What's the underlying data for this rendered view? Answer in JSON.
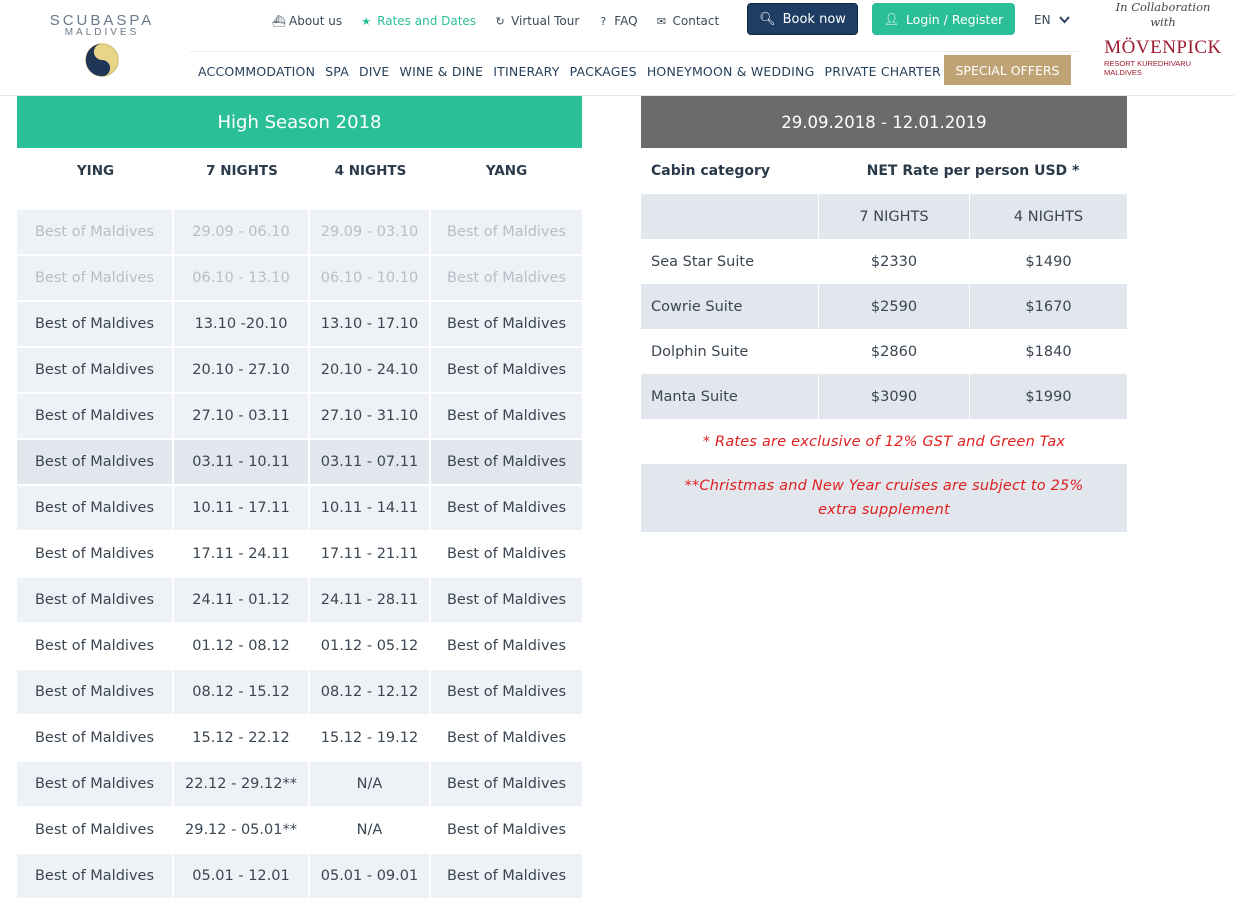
{
  "logo": {
    "title": "SCUBASPA",
    "subtitle": "MALDIVES"
  },
  "top_links": [
    {
      "icon": "ship-icon",
      "glyph": "⛴",
      "label": "About us",
      "active": false
    },
    {
      "icon": "star-icon",
      "glyph": "★",
      "label": "Rates and Dates",
      "active": true
    },
    {
      "icon": "refresh-icon",
      "glyph": "↻",
      "label": "Virtual Tour",
      "active": false
    },
    {
      "icon": "question-icon",
      "glyph": "?",
      "label": "FAQ",
      "active": false
    },
    {
      "icon": "envelope-icon",
      "glyph": "✉",
      "label": "Contact",
      "active": false
    }
  ],
  "book_button": {
    "label": "Book now",
    "icon": "search-icon"
  },
  "login_button": {
    "label": "Login / Register",
    "icon": "user-icon"
  },
  "language": {
    "value": "EN"
  },
  "main_nav": [
    "ACCOMMODATION",
    "SPA",
    "DIVE",
    "WINE & DINE",
    "ITINERARY",
    "PACKAGES",
    "HONEYMOON & WEDDING",
    "PRIVATE CHARTER"
  ],
  "special_offers": "SPECIAL OFFERS",
  "collab": {
    "line1": "In Collaboration",
    "line2": "with",
    "brand": "MÖVENPICK",
    "sub1": "RESORT KUREDHIVARU",
    "sub2": "MALDIVES"
  },
  "season_table": {
    "title": "High Season 2018",
    "headers": [
      "YING",
      "7 NIGHTS",
      "4 NIGHTS",
      "YANG"
    ],
    "rows": [
      [
        "Best of Maldives",
        "29.09 - 06.10",
        "29.09 - 03.10",
        "Best of Maldives"
      ],
      [
        "Best of Maldives",
        "06.10 - 13.10",
        "06.10 - 10.10",
        "Best of Maldives"
      ],
      [
        "Best of Maldives",
        "13.10 -20.10",
        "13.10 - 17.10",
        "Best of Maldives"
      ],
      [
        "Best of Maldives",
        "20.10 - 27.10",
        "20.10 - 24.10",
        "Best of Maldives"
      ],
      [
        "Best of Maldives",
        "27.10 - 03.11",
        "27.10 - 31.10",
        "Best of Maldives"
      ],
      [
        "Best of Maldives",
        "03.11 - 10.11",
        "03.11 - 07.11",
        "Best of Maldives"
      ],
      [
        "Best of Maldives",
        "10.11 - 17.11",
        "10.11 - 14.11",
        "Best of Maldives"
      ],
      [
        "Best of Maldives",
        "17.11 - 24.11",
        "17.11 - 21.11",
        "Best of Maldives"
      ],
      [
        "Best of Maldives",
        "24.11 - 01.12",
        "24.11 - 28.11",
        "Best of Maldives"
      ],
      [
        "Best of Maldives",
        "01.12 - 08.12",
        "01.12 - 05.12",
        "Best of Maldives"
      ],
      [
        "Best of Maldives",
        "08.12 - 15.12",
        "08.12 - 12.12",
        "Best of Maldives"
      ],
      [
        "Best of Maldives",
        "15.12 - 22.12",
        "15.12 - 19.12",
        "Best of Maldives"
      ],
      [
        "Best of Maldives",
        "22.12 - 29.12**",
        "N/A",
        "Best of Maldives"
      ],
      [
        "Best of Maldives",
        "29.12 - 05.01**",
        "N/A",
        "Best of Maldives"
      ],
      [
        "Best of Maldives",
        "05.01 - 12.01",
        "05.01 - 09.01",
        "Best of Maldives"
      ]
    ]
  },
  "rate_table": {
    "title": "29.09.2018 - 12.01.2019",
    "header_category": "Cabin category",
    "header_rate": "NET Rate per person USD *",
    "sub_headers": [
      "7 NIGHTS",
      "4 NIGHTS"
    ],
    "rows": [
      {
        "name": "Sea Star Suite",
        "seven": "$2330",
        "four": "$1490"
      },
      {
        "name": "Cowrie Suite",
        "seven": "$2590",
        "four": "$1670"
      },
      {
        "name": "Dolphin Suite",
        "seven": "$2860",
        "four": "$1840"
      },
      {
        "name": "Manta Suite",
        "seven": "$3090",
        "four": "$1990"
      }
    ],
    "note1": "* Rates are exclusive of 12% GST and Green Tax",
    "note2": "**Christmas and New Year cruises are subject to 25% extra supplement"
  }
}
